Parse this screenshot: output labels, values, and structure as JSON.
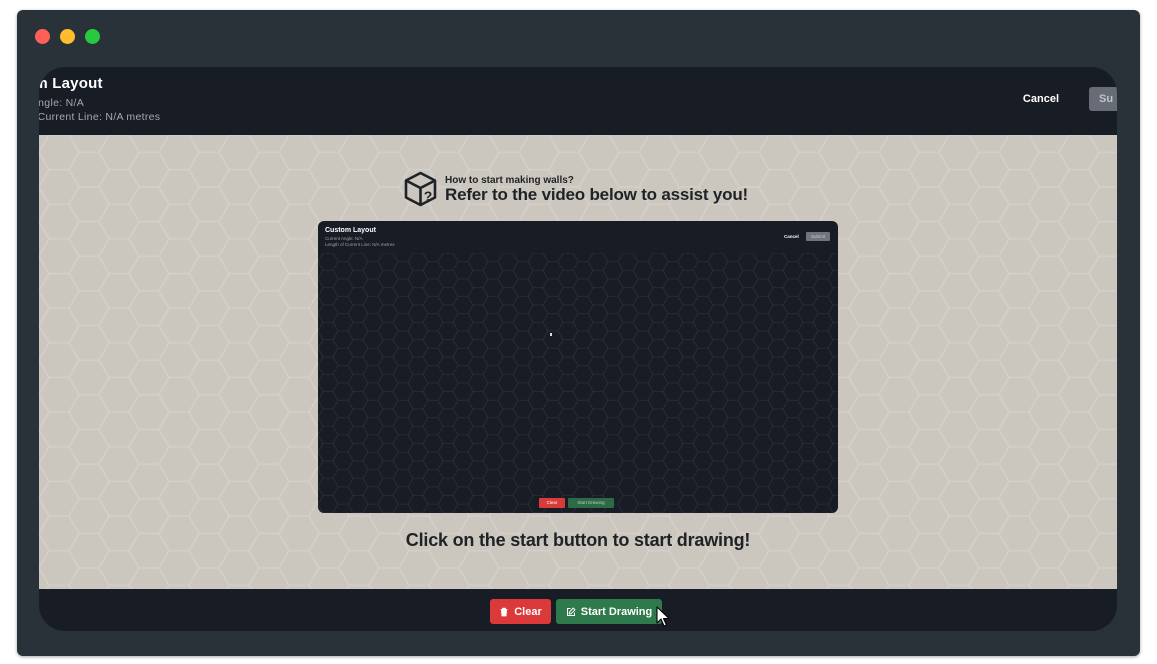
{
  "header": {
    "title": "om Layout",
    "angle_text": ": Angle: N/A",
    "length_text": "of Current Line: N/A metres",
    "cancel_label": "Cancel",
    "submit_label": "Su"
  },
  "help": {
    "small_text": "How to start making walls?",
    "big_text": "Refer to the video below to assist you!",
    "icon": "box-question-icon"
  },
  "video": {
    "title": "Custom Layout",
    "angle_text": "Current Angle: N/A",
    "length_text": "Length of Current Line: N/A metres",
    "cancel_label": "Cancel",
    "submit_label": "Submit",
    "clear_label": "Clear",
    "start_label": "Start Drawing"
  },
  "instruction": "Click on the start button to start drawing!",
  "footer": {
    "clear_label": "Clear",
    "start_label": "Start Drawing"
  },
  "colors": {
    "app_bg": "#181c25",
    "canvas_bg": "#cbc7bf",
    "clear_red": "#dc3a3a",
    "start_green": "#2f7a4c",
    "window_chrome": "#283238"
  }
}
